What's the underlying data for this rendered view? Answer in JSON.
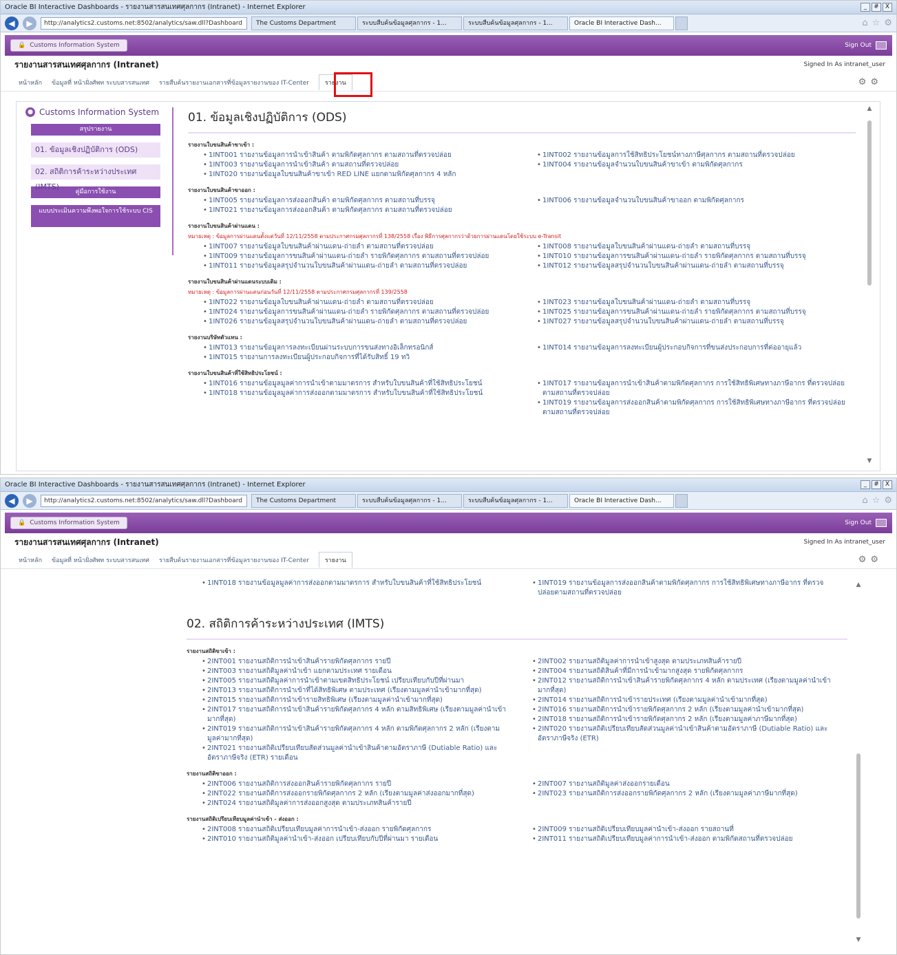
{
  "browser": {
    "window_title": "Oracle BI Interactive Dashboards - รายงานสารสนเทศศุลกากร (Intranet) - Internet Explorer",
    "address": "http://analytics2.customs.net:8502/analytics/saw.dll?Dashboard",
    "tabs": [
      "The Customs Department",
      "ระบบสืบค้นข้อมูลศุลกากร - 1...",
      "ระบบสืบค้นข้อมูลศุลกากร - 1...",
      "Oracle BI Interactive Dash..."
    ],
    "win_controls": [
      "_",
      "#",
      "X"
    ]
  },
  "app": {
    "name": "Customs Information System",
    "sign_out": "Sign Out",
    "report_title": "รายงานสารสนเทศศุลกากร (Intranet)",
    "signed_in": "Signed In As  intranet_user"
  },
  "breadcrumbs": [
    "หน้าหลัก",
    "ข้อมูลที่ หน้าฝั่งศัพท ระบบสารสนเทศ",
    "รายสืบค้นรายงานเอกสารที่ข้อมูลรายงานของ IT-Center",
    "รายงาน"
  ],
  "sidebar": {
    "title": "Customs Information System",
    "items": [
      {
        "label": "สรุปรายงาน",
        "type": "header"
      },
      {
        "label": "01. ข้อมูลเชิงปฏิบัติการ (ODS)",
        "type": "link"
      },
      {
        "label": "02. สถิติการค้าระหว่างประเทศ (IMTS)",
        "type": "link"
      },
      {
        "label": "คู่มือการใช้งาน",
        "type": "header"
      },
      {
        "label": "แบบประเมินความพึงพอใจการใช้ระบบ CIS",
        "type": "header"
      }
    ]
  },
  "section1": {
    "title": "01. ข้อมูลเชิงปฏิบัติการ (ODS)",
    "groups": [
      {
        "label": "รายงานใบขนสินค้าขาเข้า :",
        "left": [
          "1INT001 รายงานข้อมูลการนำเข้าสินค้า ตามพิกัดศุลกากร ตามสถานที่ตรวจปล่อย",
          "1INT003 รายงานข้อมูลการนำเข้าสินค้า ตามสถานที่ตรวจปล่อย",
          "1INT020 รายงานข้อมูลใบขนสินค้าขาเข้า RED LINE แยกตามพิกัดศุลกากร 4 หลัก"
        ],
        "right": [
          "1INT002 รายงานข้อมูลการใช้สิทธิประโยชน์ทางภาษีศุลกากร ตามสถานที่ตรวจปล่อย",
          "1INT004 รายงานข้อมูลจำนวนใบขนสินค้าขาเข้า ตามพิกัดศุลกากร"
        ]
      },
      {
        "label": "รายงานใบขนสินค้าขาออก :",
        "left": [
          "1INT005 รายงานข้อมูลการส่งออกสินค้า ตามพิกัดศุลกากร ตามสถานที่บรรจุ",
          "1INT021 รายงานข้อมูลการส่งออกสินค้า ตามพิกัดศุลกากร ตามสถานที่ตรวจปล่อย"
        ],
        "right": [
          "1INT006 รายงานข้อมูลจำนวนใบขนสินค้าขาออก ตามพิกัดศุลกากร"
        ]
      },
      {
        "label": "รายงานใบขนสินค้าผ่านแดน :",
        "note": "หมายเหตุ : ข้อมูลการผ่านแดนตั้งแต่วันที่ 12/11/2558 ตามประกาศกรมศุลกากรที่ 138/2558 เรื่อง พิธีการศุลกากรว่าด้วยการผ่านแดนโดยใช้ระบบ e-Transit",
        "left": [
          "1INT007 รายงานข้อมูลใบขนสินค้าผ่านแดน-ถ่ายลำ ตามสถานที่ตรวจปล่อย",
          "1INT009 รายงานข้อมูลการขนสินค้าผ่านแดน-ถ่ายลำ รายพิกัดศุลกากร ตามสถานที่ตรวจปล่อย",
          "1INT011 รายงานข้อมูลสรุปจำนวนใบขนสินค้าผ่านแดน-ถ่ายลำ ตามสถานที่ตรวจปล่อย"
        ],
        "right": [
          "1INT008 รายงานข้อมูลใบขนสินค้าผ่านแดน-ถ่ายลำ ตามสถานที่บรรจุ",
          "1INT010 รายงานข้อมูลการขนสินค้าผ่านแดน-ถ่ายลำ รายพิกัดศุลกากร ตามสถานที่บรรจุ",
          "1INT012 รายงานข้อมูลสรุปจำนวนใบขนสินค้าผ่านแดน-ถ่ายลำ ตามสถานที่บรรจุ"
        ]
      },
      {
        "label": "รายงานใบขนสินค้าผ่านแดนระบบเดิม :",
        "note": "หมายเหตุ : ข้อมูลการผ่านแดนก่อนวันที่ 12/11/2558 ตามประกาศกรมศุลกากรที่ 139/2558",
        "left": [
          "1INT022 รายงานข้อมูลใบขนสินค้าผ่านแดน-ถ่ายลำ ตามสถานที่ตรวจปล่อย",
          "1INT024 รายงานข้อมูลการขนสินค้าผ่านแดน-ถ่ายลำ รายพิกัดศุลกากร ตามสถานที่ตรวจปล่อย",
          "1INT026 รายงานข้อมูลสรุปจำนวนใบขนสินค้าผ่านแดน-ถ่ายลำ ตามสถานที่ตรวจปล่อย"
        ],
        "right": [
          "1INT023 รายงานข้อมูลใบขนสินค้าผ่านแดน-ถ่ายลำ ตามสถานที่บรรจุ",
          "1INT025 รายงานข้อมูลการขนสินค้าผ่านแดน-ถ่ายลำ รายพิกัดศุลกากร ตามสถานที่บรรจุ",
          "1INT027 รายงานข้อมูลสรุปจำนวนใบขนสินค้าผ่านแดน-ถ่ายลำ ตามสถานที่บรรจุ"
        ]
      },
      {
        "label": "รายงานบริษัทตัวแทน :",
        "left": [
          "1INT013 รายงานข้อมูลการลงทะเบียนผ่านระบบการขนส่งทางอิเล็กทรอนิกส์",
          "1INT015 รายงานการลงทะเบียนผู้ประกอบกิจการที่ได้รับสิทธิ์ 19 ทวิ"
        ],
        "right": [
          "1INT014 รายงานข้อมูลการลงทะเบียนผู้ประกอบกิจการที่ขนส่งประกอบการที่ต่ออายุแล้ว"
        ]
      },
      {
        "label": "รายงานใบขนสินค้าที่ใช้สิทธิประโยชน์ :",
        "left": [
          "1INT016 รายงานข้อมูลมูลค่าการนำเข้าตามมาตรการ สำหรับใบขนสินค้าที่ใช้สิทธิประโยชน์",
          "1INT018 รายงานข้อมูลมูลค่าการส่งออกตามมาตรการ สำหรับใบขนสินค้าที่ใช้สิทธิประโยชน์"
        ],
        "right": [
          "1INT017 รายงานข้อมูลการนำเข้าสินค้าตามพิกัดศุลกากร การใช้สิทธิพิเศษทางภาษีอากร ที่ตรวจปล่อยตามสถานที่ตรวจปล่อย",
          "1INT019 รายงานข้อมูลการส่งออกสินค้าตามพิกัดศุลกากร การใช้สิทธิพิเศษทางภาษีอากร ที่ตรวจปล่อยตามสถานที่ตรวจปล่อย"
        ]
      }
    ]
  },
  "section1_tail": {
    "left": [
      "1INT018 รายงานข้อมูลมูลค่าการส่งออกตามมาตรการ สำหรับใบขนสินค้าที่ใช้สิทธิประโยชน์"
    ],
    "right": [
      "1INT019 รายงานข้อมูลการส่งออกสินค้าตามพิกัดศุลกากร การใช้สิทธิพิเศษทางภาษีอากร ที่ตรวจปล่อยตามสถานที่ตรวจปล่อย"
    ]
  },
  "section2": {
    "title": "02. สถิติการค้าระหว่างประเทศ (IMTS)",
    "groups": [
      {
        "label": "รายงานสถิติขาเข้า :",
        "left": [
          "2INT001 รายงานสถิติการนำเข้าสินค้ารายพิกัดศุลกากร รายปี",
          "2INT003 รายงานสถิติมูลค่านำเข้า แยกตามประเทศ รายเดือน",
          "2INT005 รายงานสถิติมูลค่าการนำเข้าตามเขตสิทธิประโยชน์ เปรียบเทียบกับปีที่ผ่านมา",
          "2INT013 รายงานสถิติการนำเข้าที่ได้สิทธิพิเศษ ตามประเทศ (เรียงตามมูลค่านำเข้ามากที่สุด)",
          "2INT015 รายงานสถิติการนำเข้ารายสิทธิพิเศษ (เรียงตามมูลค่านำเข้ามากที่สุด)",
          "2INT017 รายงานสถิติการนำเข้าสินค้ารายพิกัดศุลกากร 4 หลัก ตามสิทธิพิเศษ (เรียงตามมูลค่านำเข้ามากที่สุด)",
          "2INT019 รายงานสถิติการนำเข้าสินค้ารายพิกัดศุลกากร 4 หลัก ตามพิกัดศุลกากร 2 หลัก (เรียงตามมูลค่ามากที่สุด)",
          "2INT021 รายงานสถิติเปรียบเทียบสัดส่วนมูลค่านำเข้าสินค้าตามอัตราภาษี (Dutiable Ratio) และอัตราภาษีจริง (ETR) รายเดือน"
        ],
        "right": [
          "2INT002 รายงานสถิติมูลค่าการนำเข้าสูงสุด ตามประเภทสินค้ารายปี",
          "2INT004 รายงานสถิติสินค้าที่มีการนำเข้ามากสูงสุด รายพิกัดศุลกากร",
          "2INT012 รายงานสถิติการนำเข้าสินค้ารายพิกัดศุลกากร 4 หลัก ตามประเทศ (เรียงตามมูลค่านำเข้ามากที่สุด)",
          "2INT014 รายงานสถิติการนำเข้ารายประเทศ (เรียงตามมูลค่านำเข้ามากที่สุด)",
          "2INT016 รายงานสถิติการนำเข้ารายพิกัดศุลกากร 2 หลัก (เรียงตามมูลค่านำเข้ามากที่สุด)",
          "2INT018 รายงานสถิติการนำเข้ารายพิกัดศุลกากร 2 หลัก (เรียงตามมูลค่าภาษีมากที่สุด)",
          "2INT020 รายงานสถิติเปรียบเทียบสัดส่วนมูลค่านำเข้าสินค้าตามอัตราภาษี (Dutiable Ratio) และอัตราภาษีจริง (ETR)"
        ]
      },
      {
        "label": "รายงานสถิติขาออก :",
        "left": [
          "2INT006 รายงานสถิติการส่งออกสินค้ารายพิกัดศุลกากร รายปี",
          "2INT022 รายงานสถิติการส่งออกรายพิกัดศุลกากร 2 หลัก (เรียงตามมูลค่าส่งออกมากที่สุด)",
          "2INT024 รายงานสถิติมูลค่าการส่งออกสูงสุด ตามประเภทสินค้ารายปี"
        ],
        "right": [
          "2INT007 รายงานสถิติมูลค่าส่งออกรายเดือน",
          "2INT023 รายงานสถิติการส่งออกรายพิกัดศุลกากร 2 หลัก (เรียงตามมูลค่าภาษีมากที่สุด)"
        ]
      },
      {
        "label": "รายงานสถิติเปรียบเทียบมูลค่านำเข้า - ส่งออก :",
        "left": [
          "2INT008 รายงานสถิติเปรียบเทียบมูลค่าการนำเข้า-ส่งออก รายพิกัดศุลกากร",
          "2INT010 รายงานสถิติมูลค่านำเข้า-ส่งออก เปรียบเทียบกับปีที่ผ่านมา รายเดือน"
        ],
        "right": [
          "2INT009 รายงานสถิติเปรียบเทียบมูลค่านำเข้า-ส่งออก รายสถานที่",
          "2INT011 รายงานสถิติเปรียบเทียบมูลค่าการนำเข้า-ส่งออก ตามพิกัดสถานที่ตรวจปล่อย"
        ]
      }
    ]
  },
  "ui": {
    "gear1": "⚙",
    "gear2": "⚙",
    "ie_icons": [
      "⌂",
      "☆",
      "⚙"
    ]
  },
  "colors": {
    "accent": "#8a4fb0",
    "link": "#3a5a8c",
    "note": "#d02020",
    "highlight": "#e01010"
  }
}
